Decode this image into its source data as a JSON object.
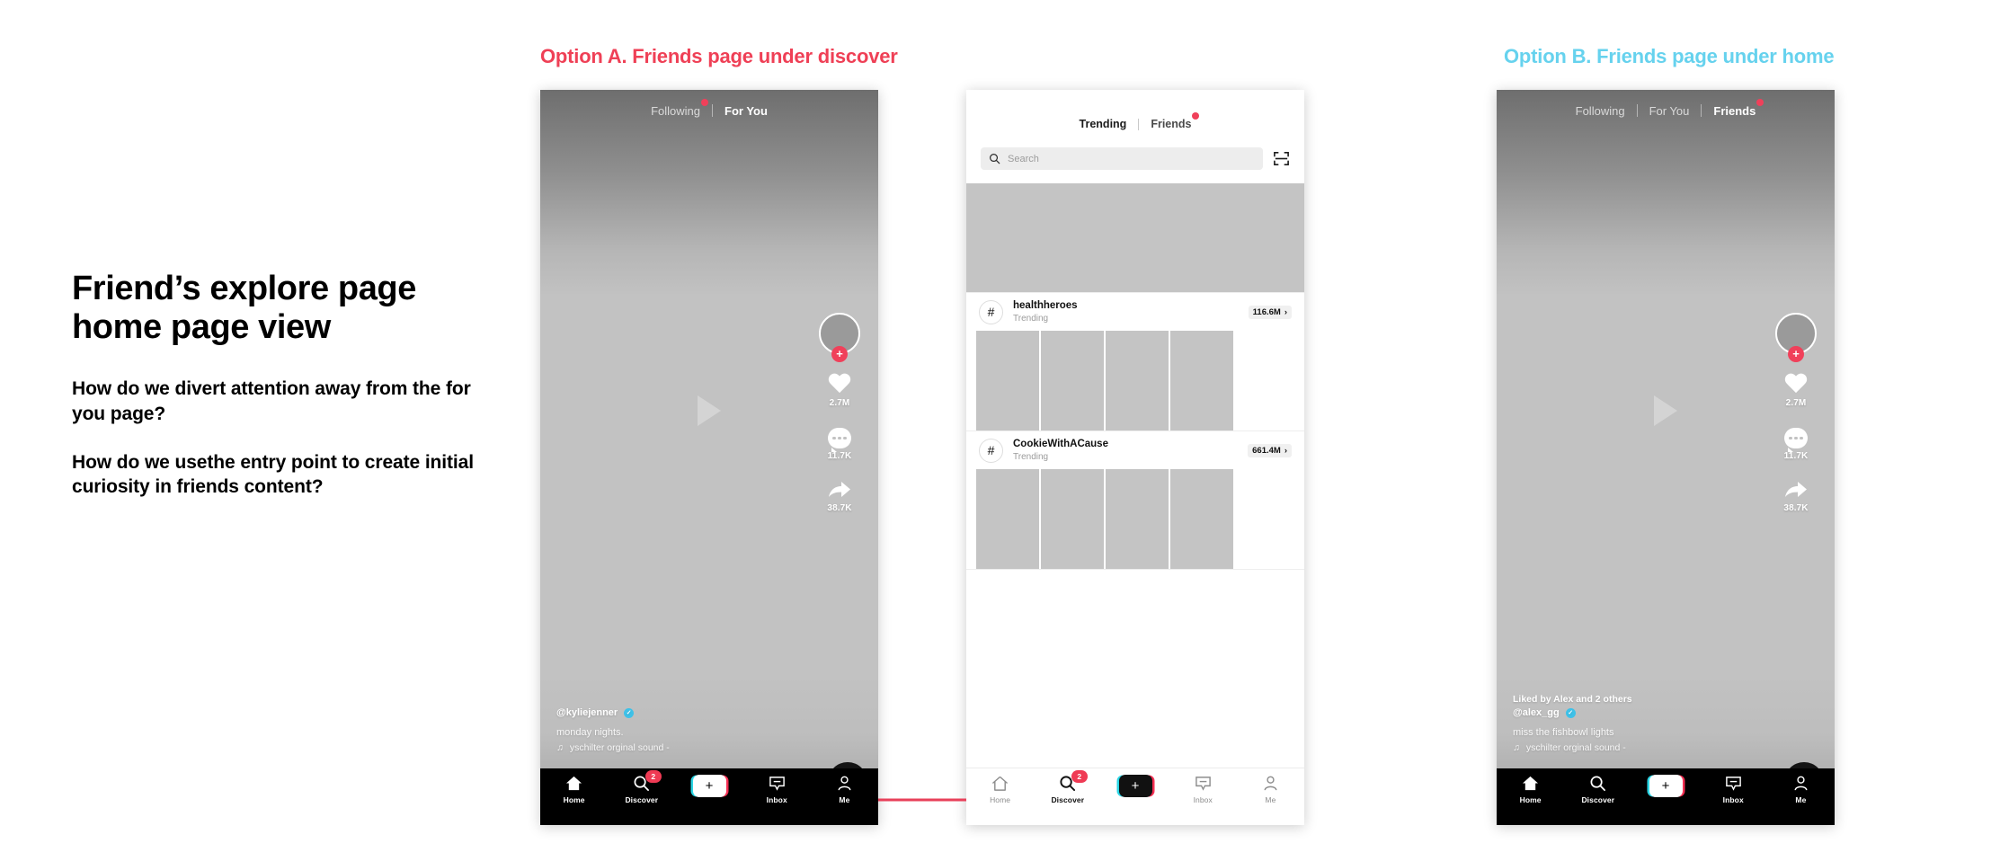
{
  "notes": {
    "title": "Friend’s explore page home page view",
    "q1": "How do we divert attention away from the for you page?",
    "q2": "How do we usethe entry point to create initial curiosity in friends content?"
  },
  "options": {
    "a_title": "Option A. Friends page under discover",
    "b_title": "Option B. Friends page under home",
    "a_color": "#ef4056",
    "b_color": "#66d2ee"
  },
  "phone_a": {
    "feed_tabs": [
      {
        "label": "Following",
        "active": false,
        "badge": true
      },
      {
        "label": "For You",
        "active": true,
        "badge": false
      }
    ],
    "rail": {
      "follow_plus": "+",
      "likes": "2.7M",
      "comments": "11.7K",
      "shares": "38.7K"
    },
    "caption": {
      "username": "@kyliejenner",
      "verified": "✓",
      "text": "monday nights.",
      "sound_icon": "♫",
      "sound": "yschilter   orginal sound -"
    },
    "tabbar": [
      {
        "label": "Home",
        "icon": "home-icon",
        "active": true,
        "badge": ""
      },
      {
        "label": "Discover",
        "icon": "search-icon",
        "active": false,
        "badge": "2"
      },
      {
        "label": "",
        "icon": "create-icon",
        "active": false,
        "badge": ""
      },
      {
        "label": "Inbox",
        "icon": "inbox-icon",
        "active": false,
        "badge": ""
      },
      {
        "label": "Me",
        "icon": "profile-icon",
        "active": false,
        "badge": ""
      }
    ],
    "create_label": "+"
  },
  "phone_b": {
    "tabs": [
      {
        "label": "Trending",
        "active": true,
        "badge": false
      },
      {
        "label": "Friends",
        "active": false,
        "badge": true
      }
    ],
    "search": {
      "placeholder": "Search",
      "icon": "search-icon",
      "scan_icon": "scan-icon"
    },
    "rows": [
      {
        "hash": "#",
        "title": "healthheroes",
        "subtitle": "Trending",
        "count": "116.6M",
        "chevron": "›"
      },
      {
        "hash": "#",
        "title": "CookieWithACause",
        "subtitle": "Trending",
        "count": "661.4M",
        "chevron": "›"
      }
    ],
    "tabbar": [
      {
        "label": "Home",
        "icon": "home-icon",
        "active": false,
        "badge": ""
      },
      {
        "label": "Discover",
        "icon": "search-icon",
        "active": true,
        "badge": "2"
      },
      {
        "label": "",
        "icon": "create-icon",
        "active": false,
        "badge": ""
      },
      {
        "label": "Inbox",
        "icon": "inbox-icon",
        "active": false,
        "badge": ""
      },
      {
        "label": "Me",
        "icon": "profile-icon",
        "active": false,
        "badge": ""
      }
    ],
    "create_label": "+"
  },
  "phone_c": {
    "feed_tabs": [
      {
        "label": "Following",
        "active": false,
        "badge": false
      },
      {
        "label": "For You",
        "active": false,
        "badge": false
      },
      {
        "label": "Friends",
        "active": true,
        "badge": true
      }
    ],
    "rail": {
      "follow_plus": "+",
      "likes": "2.7M",
      "comments": "11.7K",
      "shares": "38.7K"
    },
    "caption": {
      "liked_by": "Liked by Alex and 2 others",
      "username": "@alex_gg",
      "verified": "✓",
      "text": "miss the fishbowl lights",
      "sound_icon": "♫",
      "sound": "yschilter   orginal sound -"
    },
    "tabbar": [
      {
        "label": "Home",
        "icon": "home-icon",
        "active": true,
        "badge": ""
      },
      {
        "label": "Discover",
        "icon": "search-icon",
        "active": false,
        "badge": ""
      },
      {
        "label": "",
        "icon": "create-icon",
        "active": false,
        "badge": ""
      },
      {
        "label": "Inbox",
        "icon": "inbox-icon",
        "active": false,
        "badge": ""
      },
      {
        "label": "Me",
        "icon": "profile-icon",
        "active": false,
        "badge": ""
      }
    ],
    "create_label": "+"
  },
  "connector": {
    "color": "#e8405a"
  }
}
